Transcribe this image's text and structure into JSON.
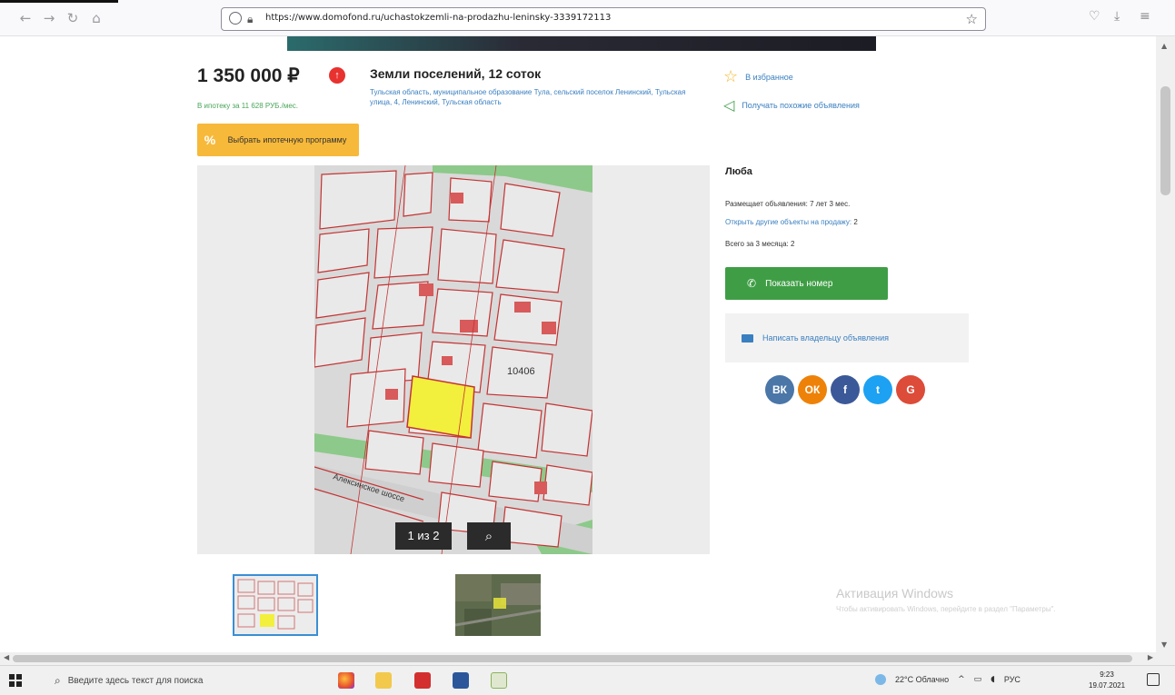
{
  "browser": {
    "url": "https://www.domofond.ru/uchastokzemli-na-prodazhu-leninsky-3339172113"
  },
  "listing": {
    "price": "1 350 000 ₽",
    "mortgage_link": "В ипотеку за 11 628 РУБ./мес.",
    "mortgage_button": "Выбрать ипотечную программу",
    "title": "Земли поселений, 12 соток",
    "address": "Тульская область, муниципальное образование Тула, сельский поселок Ленинский, Тульская улица, 4, Ленинский, Тульская область",
    "favorites_label": "В избранное",
    "similar_label": "Получать похожие объявления"
  },
  "gallery": {
    "counter": "1 из 2",
    "map_labels": {
      "street": "Алексинское шоссе",
      "cadastral": "10406"
    }
  },
  "seller": {
    "name": "Люба",
    "since": "Размещает объявления: 7 лет 3 мес.",
    "objects_link": "Открыть другие объекты на продажу:",
    "objects_count": "2",
    "recent": "Всего за 3 месяца: 2",
    "phone_button": "Показать номер",
    "write_button": "Написать владельцу объявления"
  },
  "social": [
    {
      "name": "vk",
      "label": "ВК",
      "color": "#4a76a8"
    },
    {
      "name": "ok",
      "label": "ОК",
      "color": "#ee8208"
    },
    {
      "name": "facebook",
      "label": "f",
      "color": "#3b5998"
    },
    {
      "name": "twitter",
      "label": "t",
      "color": "#1da1f2"
    },
    {
      "name": "google",
      "label": "G",
      "color": "#dd4b39"
    }
  ],
  "windows_activation": {
    "title": "Активация Windows",
    "text": "Чтобы активировать Windows, перейдите в раздел \"Параметры\"."
  },
  "taskbar": {
    "search_placeholder": "Введите здесь текст для поиска",
    "weather": "22°C  Облачно",
    "lang": "РУС",
    "time": "9:23",
    "date": "19.07.2021"
  },
  "colors": {
    "link": "#3a7fc0",
    "green": "#3f9e45",
    "mortgage": "#f7b93a",
    "badge": "#e8322f"
  }
}
